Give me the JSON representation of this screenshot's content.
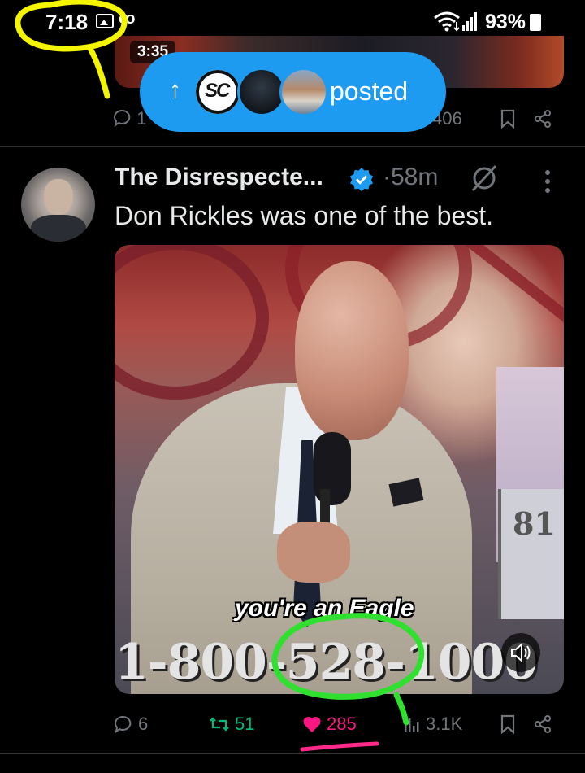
{
  "status_bar": {
    "time": "7:18",
    "voicemail_icon": "oo",
    "battery_percent": "93%",
    "icons": [
      "gallery-icon",
      "voicemail-icon",
      "wifi-icon",
      "signal-icon",
      "battery-icon"
    ]
  },
  "previous_post": {
    "video_duration": "3:35",
    "reply_count": "1",
    "views_count": "406"
  },
  "new_posts_pill": {
    "arrow": "↑",
    "label": "posted",
    "avatar_1_text": "SC"
  },
  "post": {
    "author_name": "The Disrespecte...",
    "verified": true,
    "separator": "·",
    "time_ago": "58m",
    "text": "Don Rickles was one of the best.",
    "video": {
      "caption": "you're an Eagle",
      "phone_number": "1-800-528-1000",
      "side_number": "81"
    },
    "stats": {
      "replies": "6",
      "reposts": "51",
      "likes": "285",
      "views": "3.1K"
    }
  },
  "colors": {
    "background": "#000000",
    "accent": "#1d9bf0",
    "like": "#f91880",
    "repost": "#00ba7c",
    "muted": "#71767b",
    "annotation_yellow": "#f5f500",
    "annotation_green": "#2fe02f",
    "annotation_pink": "#ff2a8a"
  }
}
